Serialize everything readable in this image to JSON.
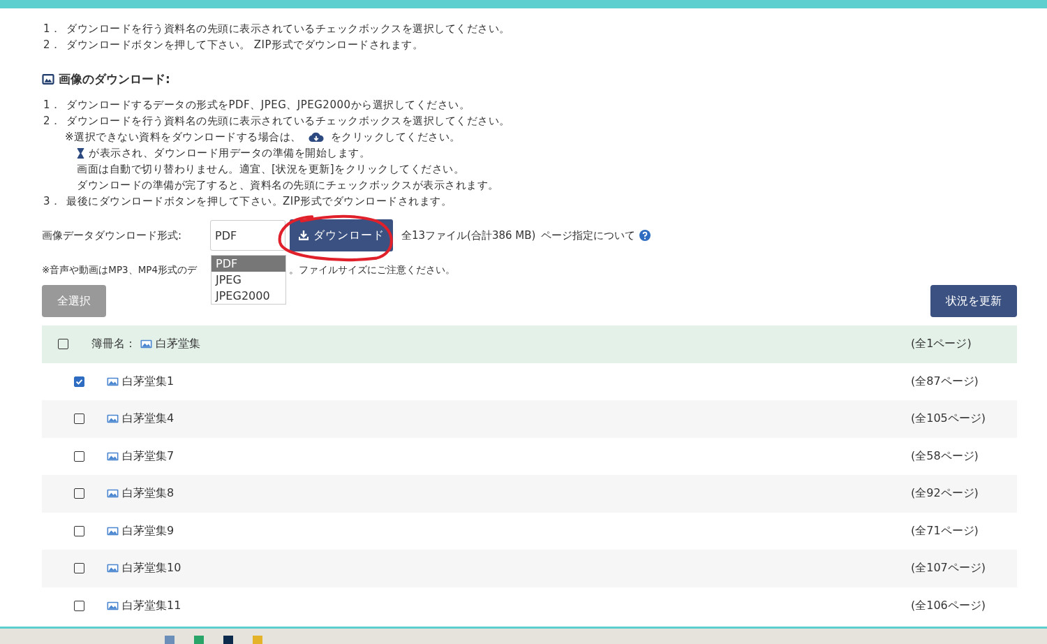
{
  "intro_steps": [
    {
      "number": "1．",
      "text": "ダウンロードを行う資料名の先頭に表示されているチェックボックスを選択してください。"
    },
    {
      "number": "2．",
      "text": "ダウンロードボタンを押して下さい。 ZIP形式でダウンロードされます。"
    }
  ],
  "image_section": {
    "title": "画像のダウンロード:",
    "steps": [
      {
        "number": "1．",
        "text": "ダウンロードするデータの形式をPDF、JPEG、JPEG2000から選択してください。"
      },
      {
        "number": "2．",
        "text": "ダウンロードを行う資料名の先頭に表示されているチェックボックスを選択してください。",
        "notes": [
          {
            "kind": "cloud",
            "before": "※選択できない資料をダウンロードする場合は、",
            "after": "をクリックしてください。"
          },
          {
            "kind": "hourglass",
            "after": "が表示され、ダウンロード用データの準備を開始します。"
          },
          {
            "kind": "plain",
            "after": "画面は自動で切り替わりません。適宜、[状況を更新]をクリックしてください。"
          },
          {
            "kind": "plain",
            "after": "ダウンロードの準備が完了すると、資料名の先頭にチェックボックスが表示されます。"
          }
        ]
      },
      {
        "number": "3．",
        "text": "最後にダウンロードボタンを押して下さい。ZIP形式でダウンロードされます。"
      }
    ]
  },
  "format_row": {
    "label": "画像データダウンロード形式:",
    "value": "PDF",
    "options": [
      {
        "label": "PDF",
        "selected": true
      },
      {
        "label": "JPEG",
        "selected": false
      },
      {
        "label": "JPEG2000",
        "selected": false
      }
    ],
    "download_button": "ダウンロード",
    "summary": "全13ファイル(合計386 MB)",
    "help_link": "ページ指定について"
  },
  "note": {
    "before": "※音声や動画はMP3、MP4形式のデ",
    "after": "。ファイルサイズにご注意ください。"
  },
  "select_all_button": {
    "label": "全選択",
    "disabled": true
  },
  "refresh_button": "状況を更新",
  "table": {
    "header": {
      "checked": false,
      "label": "簿冊名：",
      "title": "白茅堂集",
      "pages": "(全1ページ)"
    },
    "rows": [
      {
        "checked": true,
        "title": "白茅堂集1",
        "pages": "(全87ページ)"
      },
      {
        "checked": false,
        "title": "白茅堂集4",
        "pages": "(全105ページ)"
      },
      {
        "checked": false,
        "title": "白茅堂集7",
        "pages": "(全58ページ)"
      },
      {
        "checked": false,
        "title": "白茅堂集8",
        "pages": "(全92ページ)"
      },
      {
        "checked": false,
        "title": "白茅堂集9",
        "pages": "(全71ページ)"
      },
      {
        "checked": false,
        "title": "白茅堂集10",
        "pages": "(全107ページ)"
      },
      {
        "checked": false,
        "title": "白茅堂集11",
        "pages": "(全106ページ)"
      }
    ]
  }
}
